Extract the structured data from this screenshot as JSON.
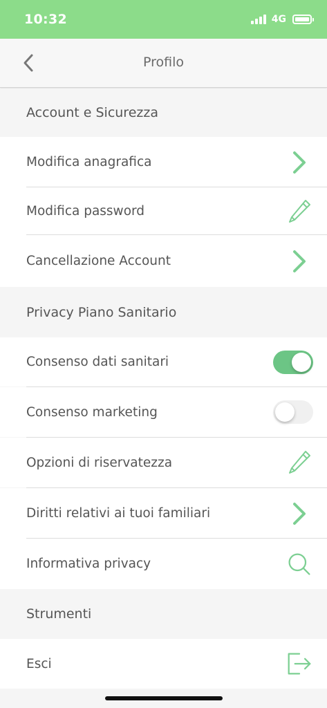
{
  "status_bar": {
    "time": "10:32",
    "network": "4G"
  },
  "nav": {
    "title": "Profilo"
  },
  "sections": [
    {
      "title": "Account e Sicurezza",
      "items": [
        {
          "label": "Modifica anagrafica",
          "icon": "chevron-right-icon"
        },
        {
          "label": "Modifica password",
          "icon": "pencil-icon"
        },
        {
          "label": "Cancellazione Account",
          "icon": "chevron-right-icon"
        }
      ]
    },
    {
      "title": "Privacy Piano Sanitario",
      "items": [
        {
          "label": "Consenso dati sanitari",
          "toggle": true
        },
        {
          "label": "Consenso marketing",
          "toggle": false
        },
        {
          "label": "Opzioni di riservatezza",
          "icon": "pencil-icon"
        },
        {
          "label": "Diritti relativi ai tuoi familiari",
          "icon": "chevron-right-icon"
        },
        {
          "label": "Informativa privacy",
          "icon": "search-icon"
        }
      ]
    },
    {
      "title": "Strumenti",
      "items": [
        {
          "label": "Esci",
          "icon": "logout-icon"
        }
      ]
    }
  ],
  "colors": {
    "accent": "#6cc585",
    "status_bar": "#8cdc8a",
    "icon": "#7ccf92"
  }
}
